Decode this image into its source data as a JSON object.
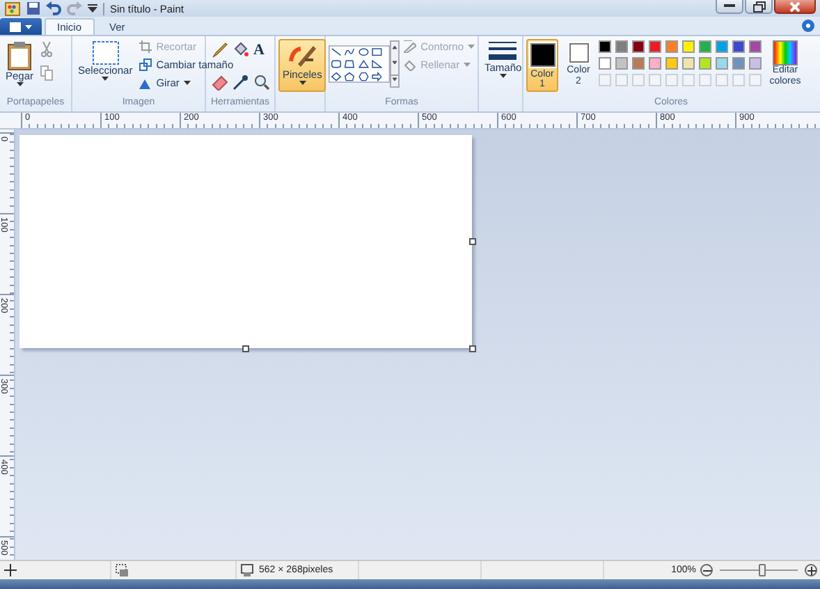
{
  "window": {
    "title": "Sin título - Paint"
  },
  "tabs": [
    {
      "label": "Inicio",
      "selected": true
    },
    {
      "label": "Ver",
      "selected": false
    }
  ],
  "clipboard": {
    "label": "Portapapeles",
    "paste": "Pegar"
  },
  "image": {
    "label": "Imagen",
    "select": "Seleccionar",
    "crop": {
      "label": "Recortar",
      "disabled": true
    },
    "resize": {
      "label": "Cambiar tamaño",
      "disabled": false
    },
    "rotate": {
      "label": "Girar",
      "disabled": false
    }
  },
  "tools": {
    "label": "Herramientas",
    "text_tool": "A"
  },
  "brushes": {
    "label": "Pinceles",
    "selected": true
  },
  "shapes": {
    "label": "Formas",
    "outline": {
      "label": "Contorno",
      "disabled": true
    },
    "fill": {
      "label": "Rellenar",
      "disabled": true
    }
  },
  "size": {
    "label": "Tamaño"
  },
  "colors": {
    "label": "Colores",
    "edit": "Editar colores",
    "slots": [
      {
        "label": "Color 1",
        "selected": true,
        "color": "#000000"
      },
      {
        "label": "Color 2",
        "selected": false,
        "color": "#ffffff"
      }
    ],
    "palette": [
      {
        "color": "#000000"
      },
      {
        "color": "#7f7f7f"
      },
      {
        "color": "#880015"
      },
      {
        "color": "#ed1c24"
      },
      {
        "color": "#ff7f27"
      },
      {
        "color": "#fff200"
      },
      {
        "color": "#22b14c"
      },
      {
        "color": "#00a2e8"
      },
      {
        "color": "#3f48cc"
      },
      {
        "color": "#a349a4"
      },
      {
        "color": "#ffffff"
      },
      {
        "color": "#c3c3c3"
      },
      {
        "color": "#b97a57"
      },
      {
        "color": "#ffaec9"
      },
      {
        "color": "#ffc90e"
      },
      {
        "color": "#efe4b0"
      },
      {
        "color": "#b5e61d"
      },
      {
        "color": "#99d9ea"
      },
      {
        "color": "#7092be"
      },
      {
        "color": "#c8bfe7"
      }
    ]
  },
  "ruler_h": [
    "0",
    "100",
    "200",
    "300",
    "400",
    "500",
    "600",
    "700",
    "800",
    "900"
  ],
  "ruler_v": [
    "0",
    "100",
    "200",
    "300",
    "400",
    "500"
  ],
  "status": {
    "size": "562 × 268pixeles",
    "zoom": "100%",
    "level": 0.55
  }
}
